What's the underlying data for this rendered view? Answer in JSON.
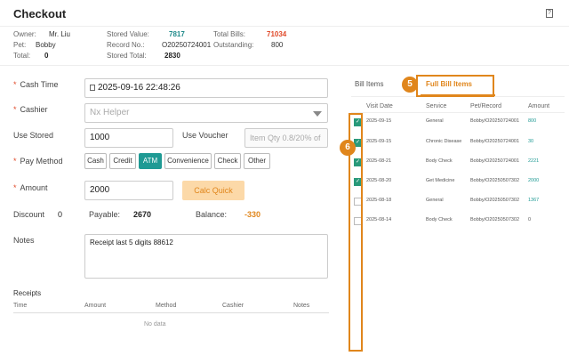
{
  "title": "Checkout",
  "help_icon": "?",
  "info": {
    "owner_label": "Owner:",
    "owner": "Mr. Liu",
    "pet_label": "Pet:",
    "pet": "Bobby",
    "total_label": "Total:",
    "total": "0",
    "stored_value_label": "Stored Value:",
    "stored_value": "7817",
    "record_no_label": "Record No.:",
    "record_no": "O20250724001",
    "stored_total_label": "Stored Total:",
    "stored_total": "2830",
    "total_bills_label": "Total Bills:",
    "total_bills": "71034",
    "outstanding_label": "Outstanding:",
    "outstanding": "800"
  },
  "form": {
    "cash_time_label": "Cash Time",
    "cash_time_icon": "calendar-icon",
    "cash_time_value": "2025-09-16 22:48:26",
    "cashier_label": "Cashier",
    "cashier_placeholder": "Nx Helper",
    "use_stored_label": "Use Stored",
    "use_stored_value": "1000",
    "use_voucher_label": "Use Voucher",
    "use_voucher_placeholder": "Item Qty 0.8/20% of",
    "pay_method_label": "Pay Method",
    "pay_methods": [
      "Cash",
      "Credit",
      "ATM",
      "Convenience",
      "Check",
      "Other"
    ],
    "pay_method_selected": "ATM",
    "amount_label": "Amount",
    "amount_value": "2000",
    "calc_button": "Calc Quick",
    "discount_label": "Discount",
    "discount_value": "0",
    "payable_label": "Payable:",
    "payable_value": "2670",
    "balance_label": "Balance:",
    "balance_value": "-330",
    "notes_label": "Notes",
    "notes_value": "Receipt last 5 digits 88612"
  },
  "receipts": {
    "title": "Receipts",
    "headers": [
      "Time",
      "Amount",
      "Method",
      "Cashier",
      "Notes"
    ],
    "empty_text": "No data"
  },
  "bill_panel": {
    "tabs": [
      "Bill Items",
      "Full Bill Items"
    ],
    "active_tab": "Full Bill Items",
    "badge_tabs": "5",
    "badge_checkboxes": "6",
    "headers": [
      "Visit Date",
      "Service",
      "Pet/Record",
      "Amount"
    ],
    "rows": [
      {
        "checked": true,
        "date": "2025-09-15",
        "service": "General",
        "record": "Bobby/O20250724001",
        "amount": "800"
      },
      {
        "checked": true,
        "date": "2025-09-15",
        "service": "Chronic Disease",
        "record": "Bobby/O20250724001",
        "amount": "30"
      },
      {
        "checked": true,
        "date": "2025-08-21",
        "service": "Body Check",
        "record": "Bobby/O20250724001",
        "amount": "2221"
      },
      {
        "checked": true,
        "date": "2025-08-20",
        "service": "Get Medicine",
        "record": "Bobby/O20250507302",
        "amount": "2000"
      },
      {
        "checked": false,
        "date": "2025-08-18",
        "service": "General",
        "record": "Bobby/O20250507302",
        "amount": "1367"
      },
      {
        "checked": false,
        "date": "2025-08-14",
        "service": "Body Check",
        "record": "Bobby/O20250507302",
        "amount": "0"
      }
    ]
  },
  "colors": {
    "accent": "#1f9a94",
    "highlight": "#e0861c",
    "danger": "#e04a2a"
  }
}
